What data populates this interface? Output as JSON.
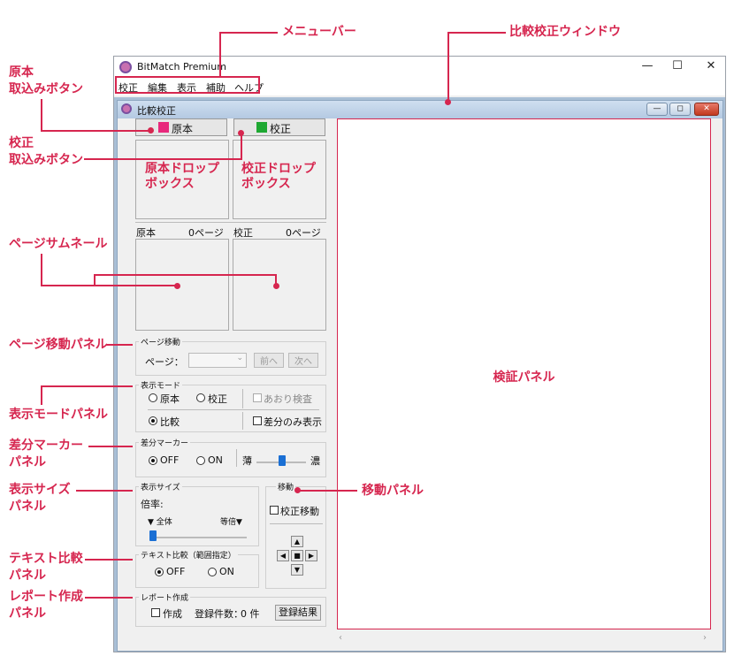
{
  "annotations": {
    "menubar": "メニューバー",
    "compare_window": "比較校正ウィンドウ",
    "orig_import": [
      "原本",
      "取込みボタン"
    ],
    "proof_import": [
      "校正",
      "取込みボタン"
    ],
    "thumbnails": "ページサムネール",
    "page_move": "ページ移動パネル",
    "display_mode": "表示モードパネル",
    "diff_marker": [
      "差分マーカー",
      "パネル"
    ],
    "display_size": [
      "表示サイズ",
      "パネル"
    ],
    "text_compare": [
      "テキスト比較",
      "パネル"
    ],
    "report": [
      "レポート作成",
      "パネル"
    ],
    "move_panel": "移動パネル"
  },
  "app": {
    "title": "BitMatch Premium",
    "window_controls": [
      "—",
      "☐",
      "✕"
    ],
    "menu": [
      "校正",
      "編集",
      "表示",
      "補助",
      "ヘルプ"
    ]
  },
  "child": {
    "title": "比較校正",
    "controls": [
      "—",
      "◻",
      "✕"
    ]
  },
  "import": {
    "original_label": "原本",
    "proof_label": "校正",
    "original_color": "#e8287c",
    "proof_color": "#1ea832"
  },
  "drop": {
    "original": [
      "原本ドロップ",
      "ボックス"
    ],
    "proof": [
      "校正ドロップ",
      "ボックス"
    ]
  },
  "thumb": {
    "original_label": "原本",
    "original_pages": "0ページ",
    "proof_label": "校正",
    "proof_pages": "0ページ"
  },
  "page_move": {
    "legend": "ページ移動",
    "label": "ページ：",
    "prev": "前へ",
    "next": "次へ"
  },
  "display_mode": {
    "legend": "表示モード",
    "original": "原本",
    "proof": "校正",
    "flicker": "あおり検査",
    "compare": "比較",
    "diff_only": "差分のみ表示"
  },
  "diff_marker": {
    "legend": "差分マーカー",
    "off": "OFF",
    "on": "ON",
    "light": "薄",
    "dark": "濃",
    "level": 0.52
  },
  "display_size": {
    "legend": "表示サイズ",
    "zoom_label": "倍率:",
    "fit_all": "▼ 全体",
    "actual": "等倍▼",
    "level": 0
  },
  "move": {
    "legend": "移動",
    "proof_move": "校正移動"
  },
  "text_compare": {
    "legend": "テキスト比較（範囲指定）",
    "off": "OFF",
    "on": "ON"
  },
  "report": {
    "legend": "レポート作成",
    "create": "作成",
    "count_label": "登録件数：",
    "count": "0 件",
    "result_button": "登録結果"
  },
  "verify": {
    "label": "検証パネル"
  }
}
